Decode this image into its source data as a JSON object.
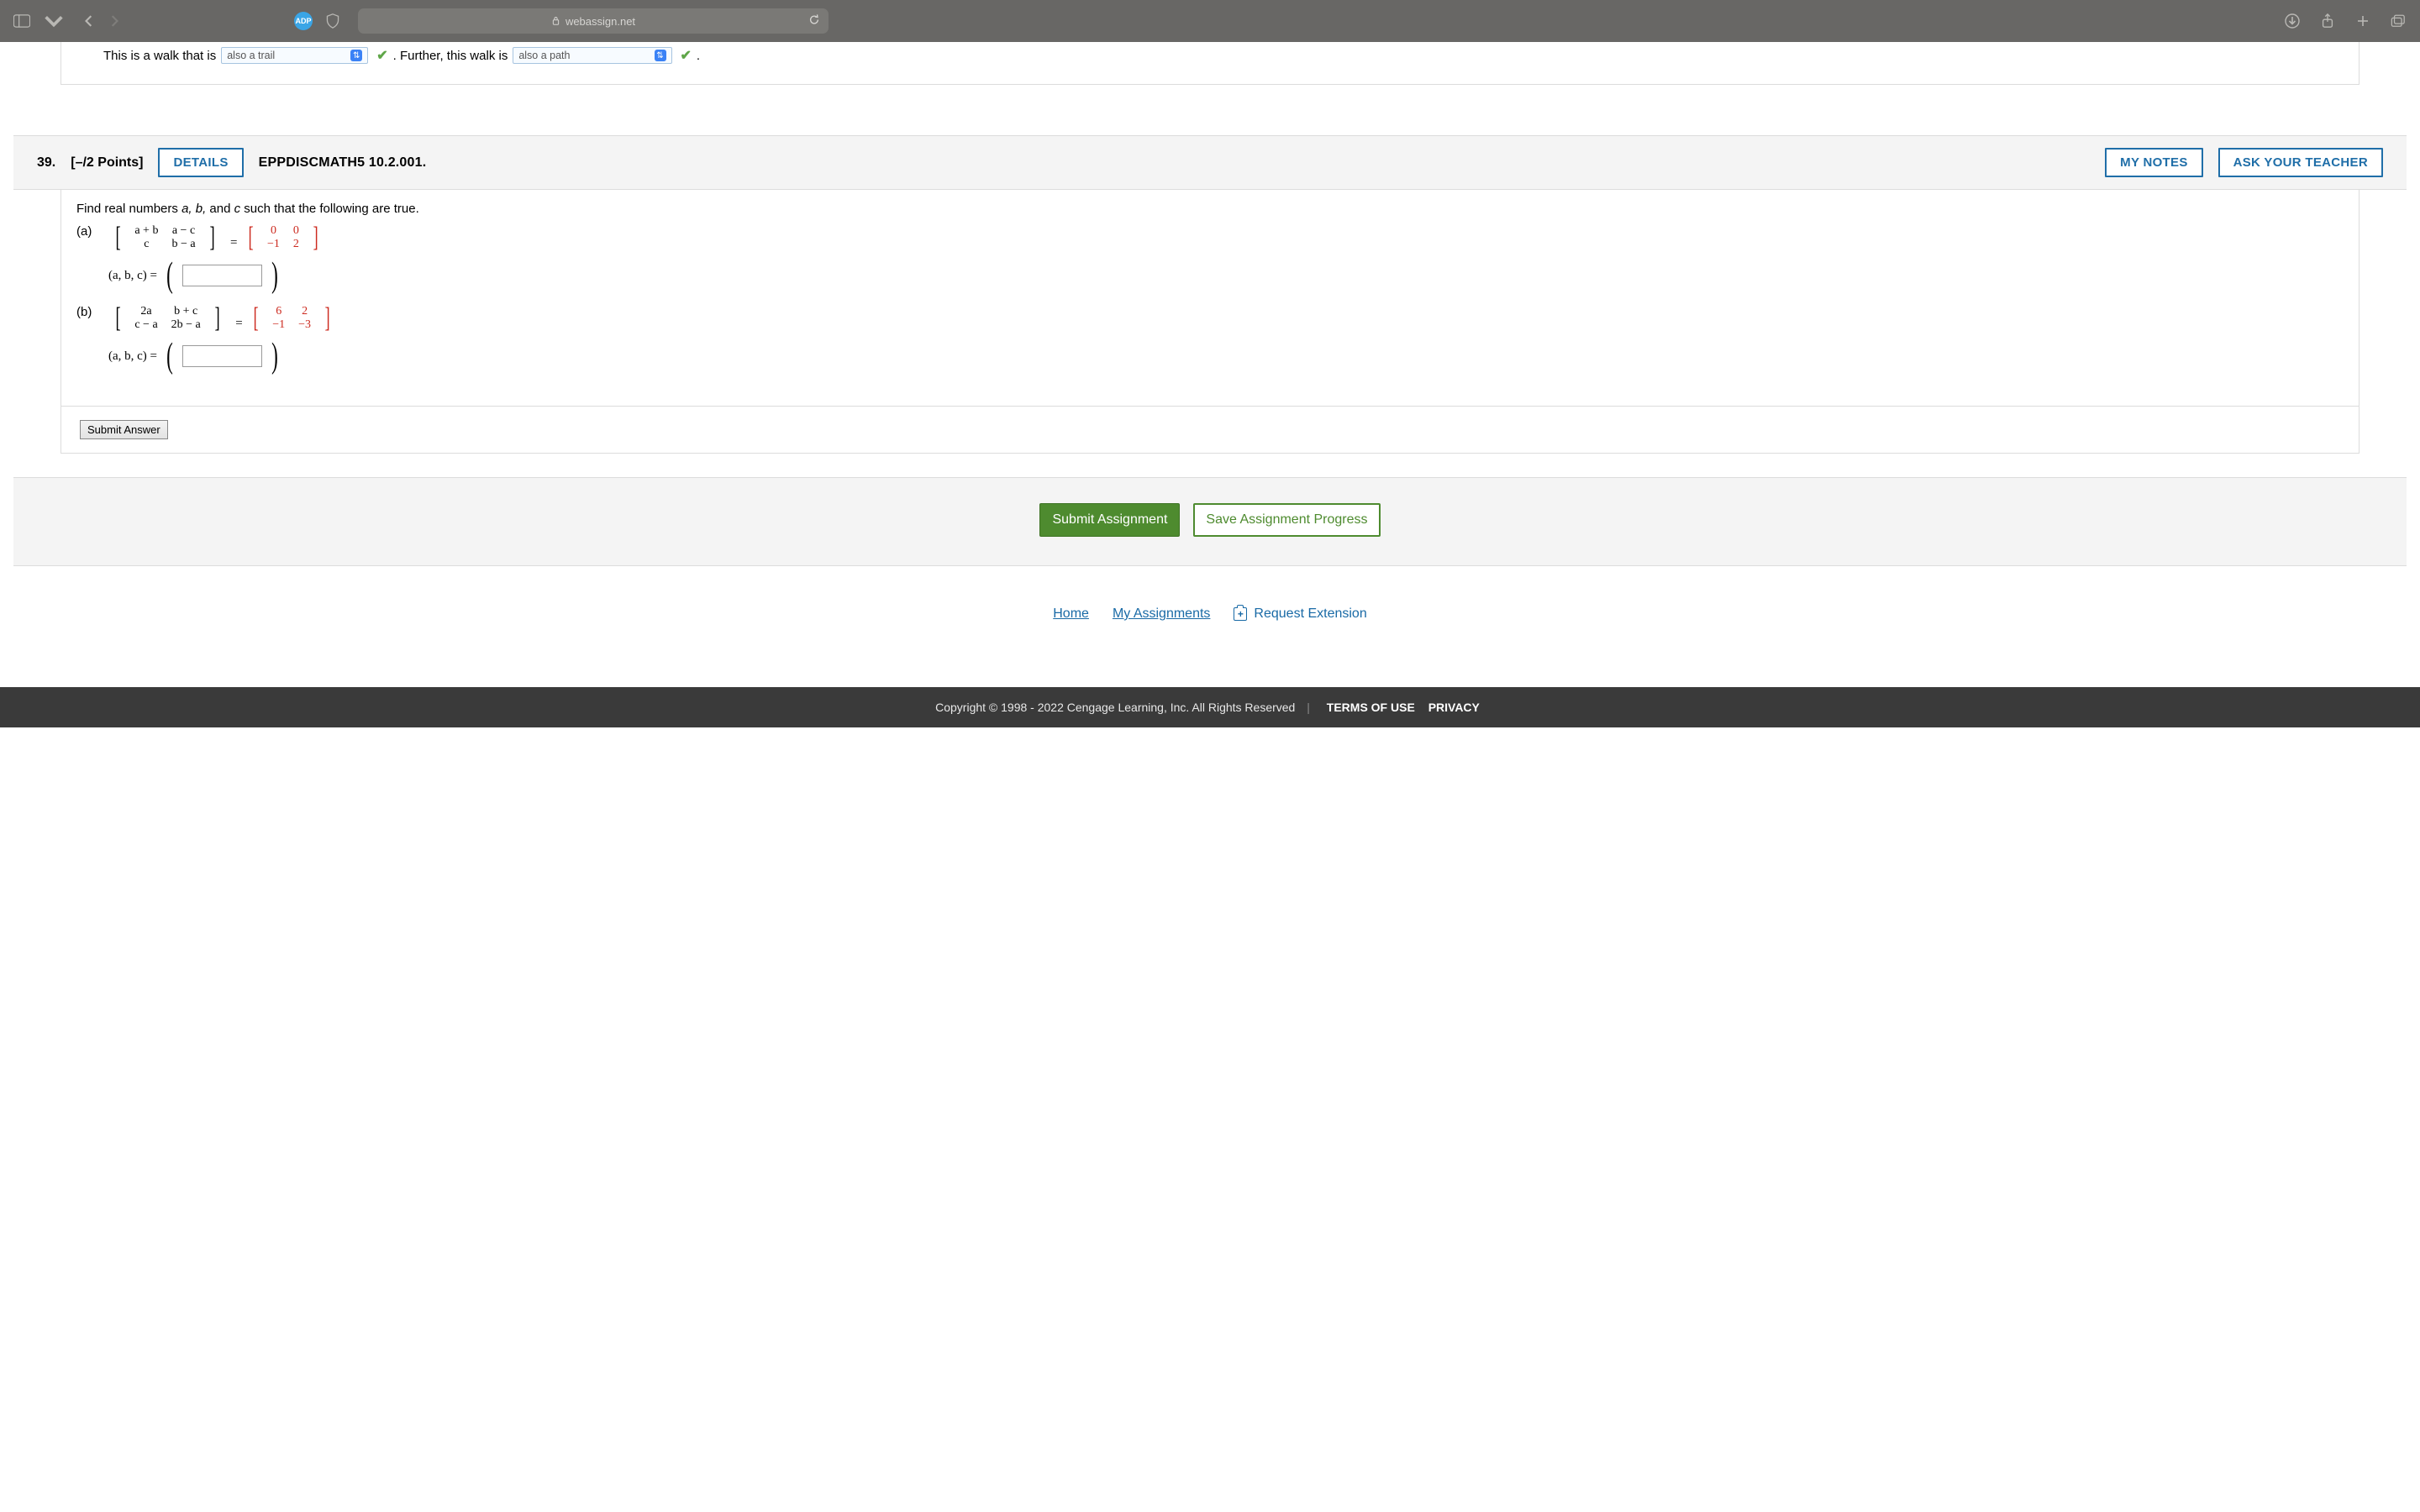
{
  "browser": {
    "url_host": "webassign.net",
    "adp_badge": "ADP"
  },
  "prev_question": {
    "lead1": "This is a walk that is",
    "select1": "also a trail",
    "mid": ". Further, this walk is",
    "select2": "also a path",
    "tail": "."
  },
  "q39": {
    "number": "39.",
    "points": "[–/2 Points]",
    "details_btn": "DETAILS",
    "reference": "EPPDISCMATH5 10.2.001.",
    "my_notes_btn": "MY NOTES",
    "ask_teacher_btn": "ASK YOUR TEACHER",
    "prompt_prefix": "Find real numbers ",
    "prompt_vars": "a, b,",
    "prompt_and": " and ",
    "prompt_var_c": "c",
    "prompt_suffix": " such that the following are true.",
    "part_a_label": "(a)",
    "part_b_label": "(b)",
    "tuple_label": "(a, b, c)  =",
    "matrix_a_left": [
      [
        "a + b",
        "a − c"
      ],
      [
        "c",
        "b − a"
      ]
    ],
    "matrix_a_right": [
      [
        "0",
        "0"
      ],
      [
        "−1",
        "2"
      ]
    ],
    "matrix_b_left": [
      [
        "2a",
        "b + c"
      ],
      [
        "c − a",
        "2b − a"
      ]
    ],
    "matrix_b_right": [
      [
        "6",
        "2"
      ],
      [
        "−1",
        "−3"
      ]
    ],
    "submit_answer_btn": "Submit Answer"
  },
  "assign_bar": {
    "submit": "Submit Assignment",
    "save": "Save Assignment Progress"
  },
  "bottom_links": {
    "home": "Home",
    "assignments": "My Assignments",
    "request_ext": "Request Extension"
  },
  "footer": {
    "copyright": "Copyright © 1998 - 2022 Cengage Learning, Inc. All Rights Reserved",
    "terms": "TERMS OF USE",
    "privacy": "PRIVACY"
  }
}
